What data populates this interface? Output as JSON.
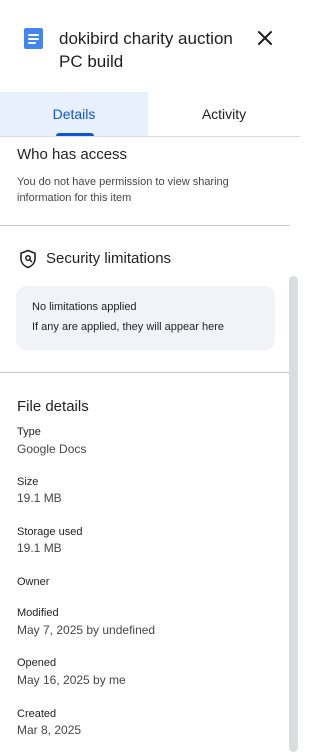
{
  "header": {
    "file_icon": "google-docs-icon",
    "title": "dokibird charity auction PC build",
    "close_icon": "close-icon"
  },
  "tabs": [
    {
      "label": "Details",
      "selected": true
    },
    {
      "label": "Activity",
      "selected": false
    }
  ],
  "access": {
    "heading": "Who has access",
    "message": "You do not have permission to view sharing information for this item"
  },
  "security": {
    "icon": "shield-lock-icon",
    "heading": "Security limitations",
    "card_title": "No limitations applied",
    "card_subtitle": "If any are applied, they will appear here"
  },
  "file_details": {
    "heading": "File details",
    "type_label": "Type",
    "type_value": "Google Docs",
    "size_label": "Size",
    "size_value": "19.1 MB",
    "storage_label": "Storage used",
    "storage_value": "19.1 MB",
    "owner_label": "Owner",
    "modified_label": "Modified",
    "modified_value": "May 7, 2025 by undefined",
    "opened_label": "Opened",
    "opened_value": "May 16, 2025 by me",
    "created_label": "Created",
    "created_value": "Mar 8, 2025"
  },
  "colors": {
    "accent": "#0b57d0",
    "selected_tab_bg": "#e8f0fe",
    "docs_icon": "#4285f4",
    "card_bg": "#f0f4f9"
  }
}
